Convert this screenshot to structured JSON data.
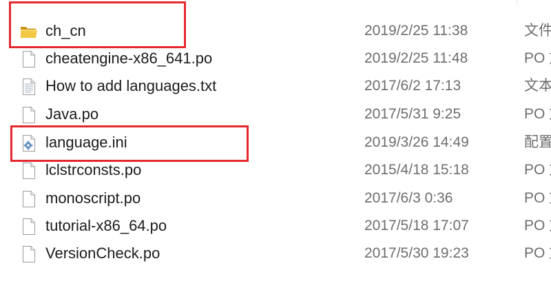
{
  "files": [
    {
      "name": "ch_cn",
      "modified": "2019/2/25 11:38",
      "type": "文件夹",
      "icon": "folder-icon"
    },
    {
      "name": "cheatengine-x86_641.po",
      "modified": "2019/2/25 11:48",
      "type": "PO 文件",
      "icon": "file-icon"
    },
    {
      "name": "How to add languages.txt",
      "modified": "2017/6/2 17:13",
      "type": "文本文档",
      "icon": "text-file-icon"
    },
    {
      "name": "Java.po",
      "modified": "2017/5/31 9:25",
      "type": "PO 文件",
      "icon": "file-icon"
    },
    {
      "name": "language.ini",
      "modified": "2019/3/26 14:49",
      "type": "配置设置",
      "icon": "settings-file-icon"
    },
    {
      "name": "lclstrconsts.po",
      "modified": "2015/4/18 15:18",
      "type": "PO 文件",
      "icon": "file-icon"
    },
    {
      "name": "monoscript.po",
      "modified": "2017/6/3 0:36",
      "type": "PO 文件",
      "icon": "file-icon"
    },
    {
      "name": "tutorial-x86_64.po",
      "modified": "2017/5/18 17:07",
      "type": "PO 文件",
      "icon": "file-icon"
    },
    {
      "name": "VersionCheck.po",
      "modified": "2017/5/30 19:23",
      "type": "PO 文件",
      "icon": "file-icon"
    }
  ],
  "highlights": [
    "ch_cn",
    "language.ini"
  ],
  "colors": {
    "highlight": "#e5272e",
    "name_text": "#1b1b1b",
    "meta_text": "#6d6d6d",
    "folder": "#e8b830"
  }
}
